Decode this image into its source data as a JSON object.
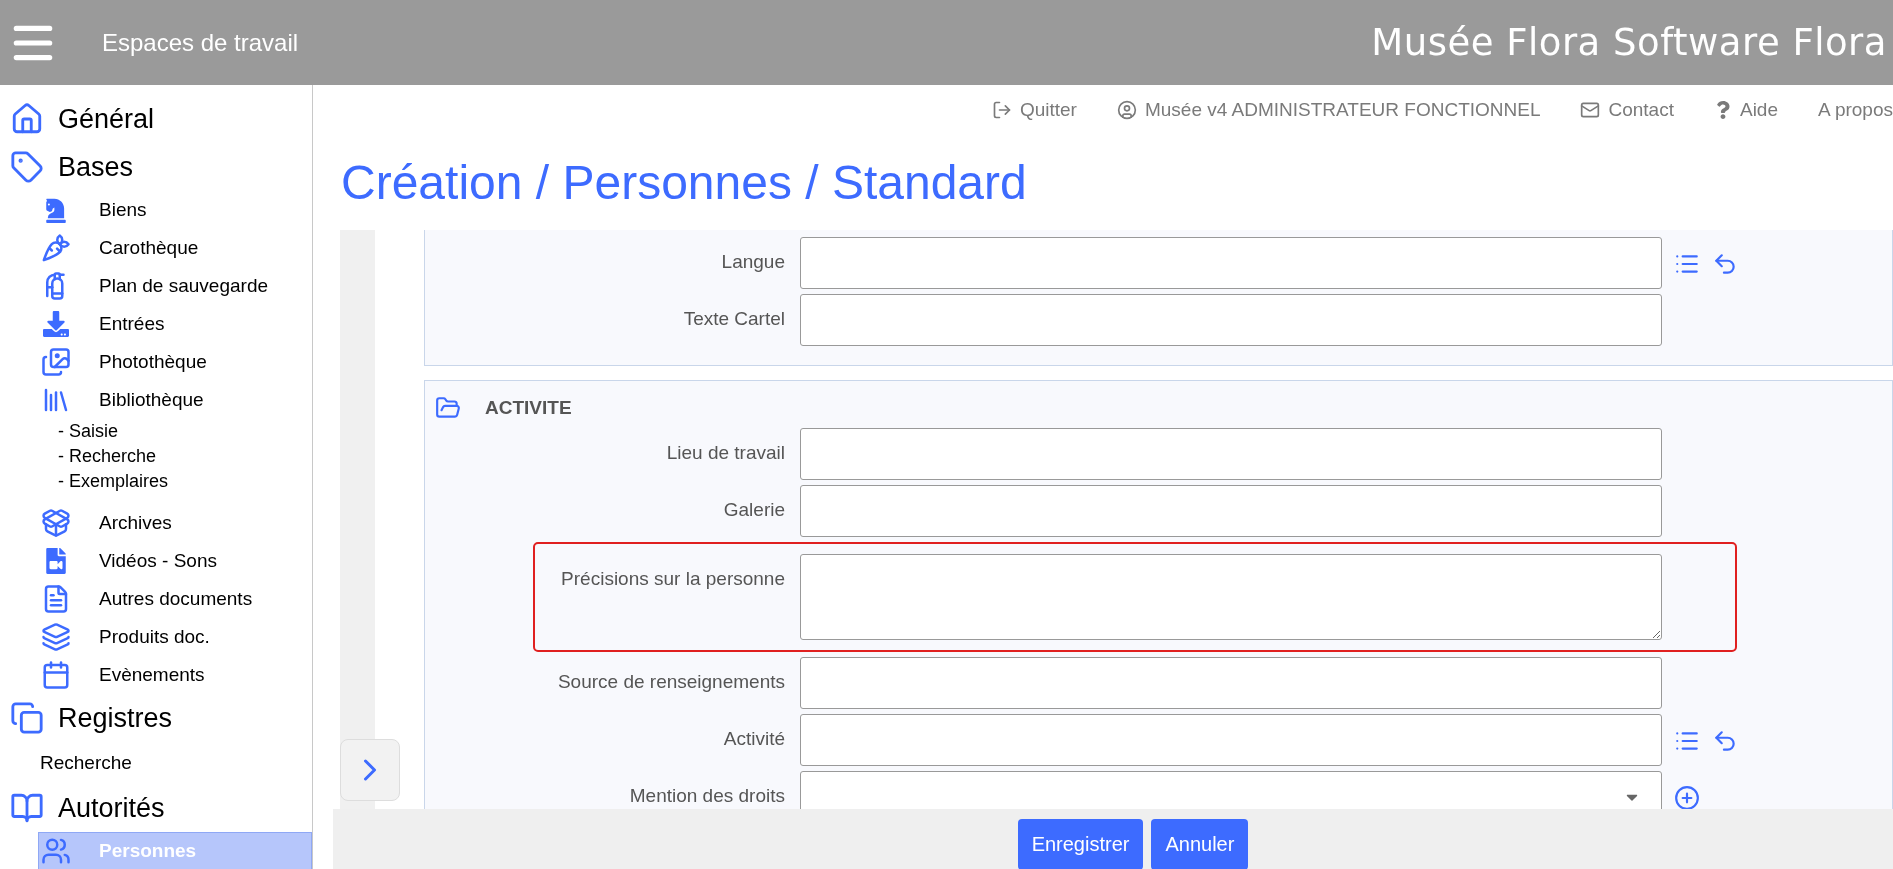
{
  "topbar": {
    "title": "Espaces de travail",
    "brand": "Musée Flora Software Flora"
  },
  "header_links": [
    {
      "label": "Quitter",
      "kind": "logout"
    },
    {
      "label": "Musée v4 ADMINISTRATEUR FONCTIONNEL",
      "kind": "user"
    },
    {
      "label": "Contact",
      "kind": "mail"
    },
    {
      "label": "Aide",
      "kind": "help"
    },
    {
      "label": "A propos",
      "kind": "plain"
    }
  ],
  "page_title": "Création / Personnes / Standard",
  "sidebar": [
    {
      "label": "Général",
      "kind": "home",
      "selected": false
    },
    {
      "label": "Bases",
      "kind": "tag",
      "selected": false,
      "children": [
        {
          "label": "Biens",
          "kind": "knight",
          "selected": false
        },
        {
          "label": "Carothèque",
          "kind": "carrot",
          "selected": false
        },
        {
          "label": "Plan de sauvegarde",
          "kind": "extinguisher",
          "selected": false
        },
        {
          "label": "Entrées",
          "kind": "download",
          "selected": false
        },
        {
          "label": "Photothèque",
          "kind": "images",
          "selected": false
        },
        {
          "label": "Bibliothèque",
          "kind": "library",
          "selected": false,
          "children": [
            {
              "label": "- Saisie",
              "selected": false
            },
            {
              "label": "- Recherche",
              "selected": false
            },
            {
              "label": "- Exemplaires",
              "selected": false
            }
          ]
        },
        {
          "label": "Archives",
          "kind": "box",
          "selected": false
        },
        {
          "label": "Vidéos - Sons",
          "kind": "video",
          "selected": false
        },
        {
          "label": "Autres documents",
          "kind": "document",
          "selected": false
        },
        {
          "label": "Produits doc.",
          "kind": "stack",
          "selected": false
        },
        {
          "label": "Evènements",
          "kind": "calendar",
          "selected": false
        }
      ]
    },
    {
      "label": "Registres",
      "kind": "copies",
      "selected": false,
      "children": [
        {
          "label": "Recherche",
          "kind": "plain",
          "selected": false
        }
      ]
    },
    {
      "label": "Autorités",
      "kind": "book",
      "selected": false,
      "children": [
        {
          "label": "Personnes",
          "kind": "users",
          "selected": true
        }
      ]
    }
  ],
  "form": {
    "sections": [
      {
        "fields": [
          {
            "label": "Langue",
            "kind": "text",
            "actions": [
              {
                "kind": "list"
              },
              {
                "kind": "undo"
              }
            ],
            "highlighted": false
          },
          {
            "label": "Texte Cartel",
            "kind": "text",
            "highlighted": false
          }
        ]
      },
      {
        "title": "ACTIVITE",
        "fields": [
          {
            "label": "Lieu de travail",
            "kind": "text",
            "highlighted": false
          },
          {
            "label": "Galerie",
            "kind": "text",
            "highlighted": false
          },
          {
            "label": "Précisions sur la personne",
            "kind": "textarea",
            "highlighted": true
          },
          {
            "label": "Source de renseignements",
            "kind": "text",
            "highlighted": false
          },
          {
            "label": "Activité",
            "kind": "text",
            "actions": [
              {
                "kind": "list"
              },
              {
                "kind": "undo"
              }
            ],
            "highlighted": false
          },
          {
            "label": "Mention des droits",
            "kind": "select",
            "actions": [
              {
                "kind": "add"
              }
            ],
            "highlighted": false
          }
        ]
      }
    ]
  },
  "buttons": [
    "Enregistrer",
    "Annuler"
  ]
}
